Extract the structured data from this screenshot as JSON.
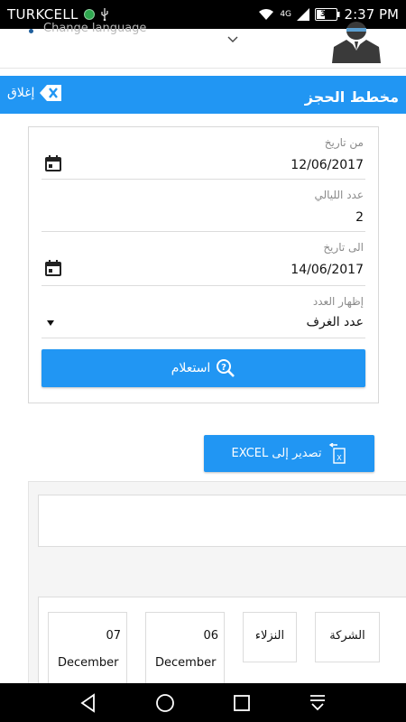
{
  "status_bar": {
    "carrier": "TURKCELL",
    "network": "4G",
    "battery": "38",
    "time": "2:37 PM"
  },
  "header": {
    "language_placeholder": "Change language"
  },
  "title_bar": {
    "close_label": "إغلاق",
    "title": "مخطط الحجز"
  },
  "form": {
    "from_date": {
      "label": "من تاريخ",
      "value": "12/06/2017"
    },
    "nights": {
      "label": "عدد الليالي",
      "value": "2"
    },
    "to_date": {
      "label": "الى تاريخ",
      "value": "14/06/2017"
    },
    "display_count": {
      "label": "إظهار العدد",
      "value": "عدد الغرف"
    },
    "query_label": "استعلام"
  },
  "export": {
    "label": "تصدير إلى EXCEL"
  },
  "grid": {
    "headers": {
      "company": "الشركة",
      "guests": "النزلاء"
    },
    "dates": [
      {
        "day": "06",
        "month": "December"
      },
      {
        "day": "07",
        "month": "December"
      }
    ]
  },
  "colors": {
    "accent": "#2196f3",
    "status_bar": "#000000",
    "grid_bg": "#f5f5f5"
  }
}
